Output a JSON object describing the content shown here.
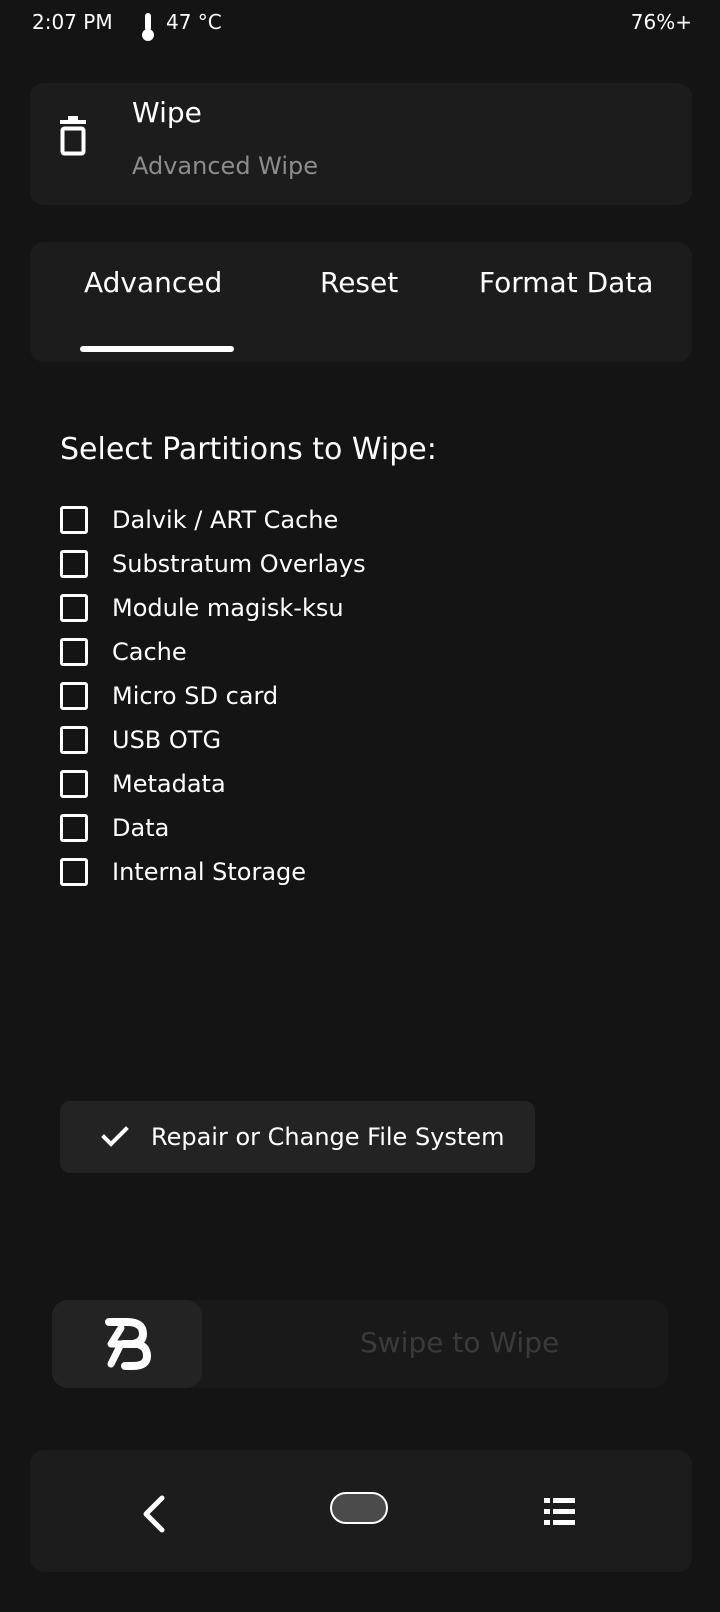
{
  "status_bar": {
    "time": "2:07 PM",
    "temperature": "47 °C",
    "battery": "76%+",
    "thermometer_icon": "thermometer-icon"
  },
  "header": {
    "icon": "trash-icon",
    "title": "Wipe",
    "subtitle": "Advanced Wipe"
  },
  "tabs": [
    {
      "label": "Advanced",
      "active": true
    },
    {
      "label": "Reset",
      "active": false
    },
    {
      "label": "Format Data",
      "active": false
    }
  ],
  "partitions": {
    "heading": "Select Partitions to Wipe:",
    "items": [
      {
        "label": "Dalvik / ART Cache",
        "checked": false
      },
      {
        "label": "Substratum Overlays",
        "checked": false
      },
      {
        "label": "Module magisk-ksu",
        "checked": false
      },
      {
        "label": "Cache",
        "checked": false
      },
      {
        "label": "Micro SD card",
        "checked": false
      },
      {
        "label": "USB OTG",
        "checked": false
      },
      {
        "label": "Metadata",
        "checked": false
      },
      {
        "label": "Data",
        "checked": false
      },
      {
        "label": "Internal Storage",
        "checked": false
      }
    ]
  },
  "repair_button": {
    "label": "Repair or Change File System",
    "icon": "check-icon"
  },
  "swipe": {
    "label": "Swipe to Wipe",
    "handle_icon": "app-logo-icon"
  },
  "nav": {
    "back_icon": "back-chevron-icon",
    "home_icon": "home-pill-icon",
    "menu_icon": "list-menu-icon"
  },
  "colors": {
    "background": "#141414",
    "card": "#1c1c1c",
    "text": "#ffffff",
    "muted": "#8c8c8c",
    "disabled_text": "#3a3a3a"
  }
}
